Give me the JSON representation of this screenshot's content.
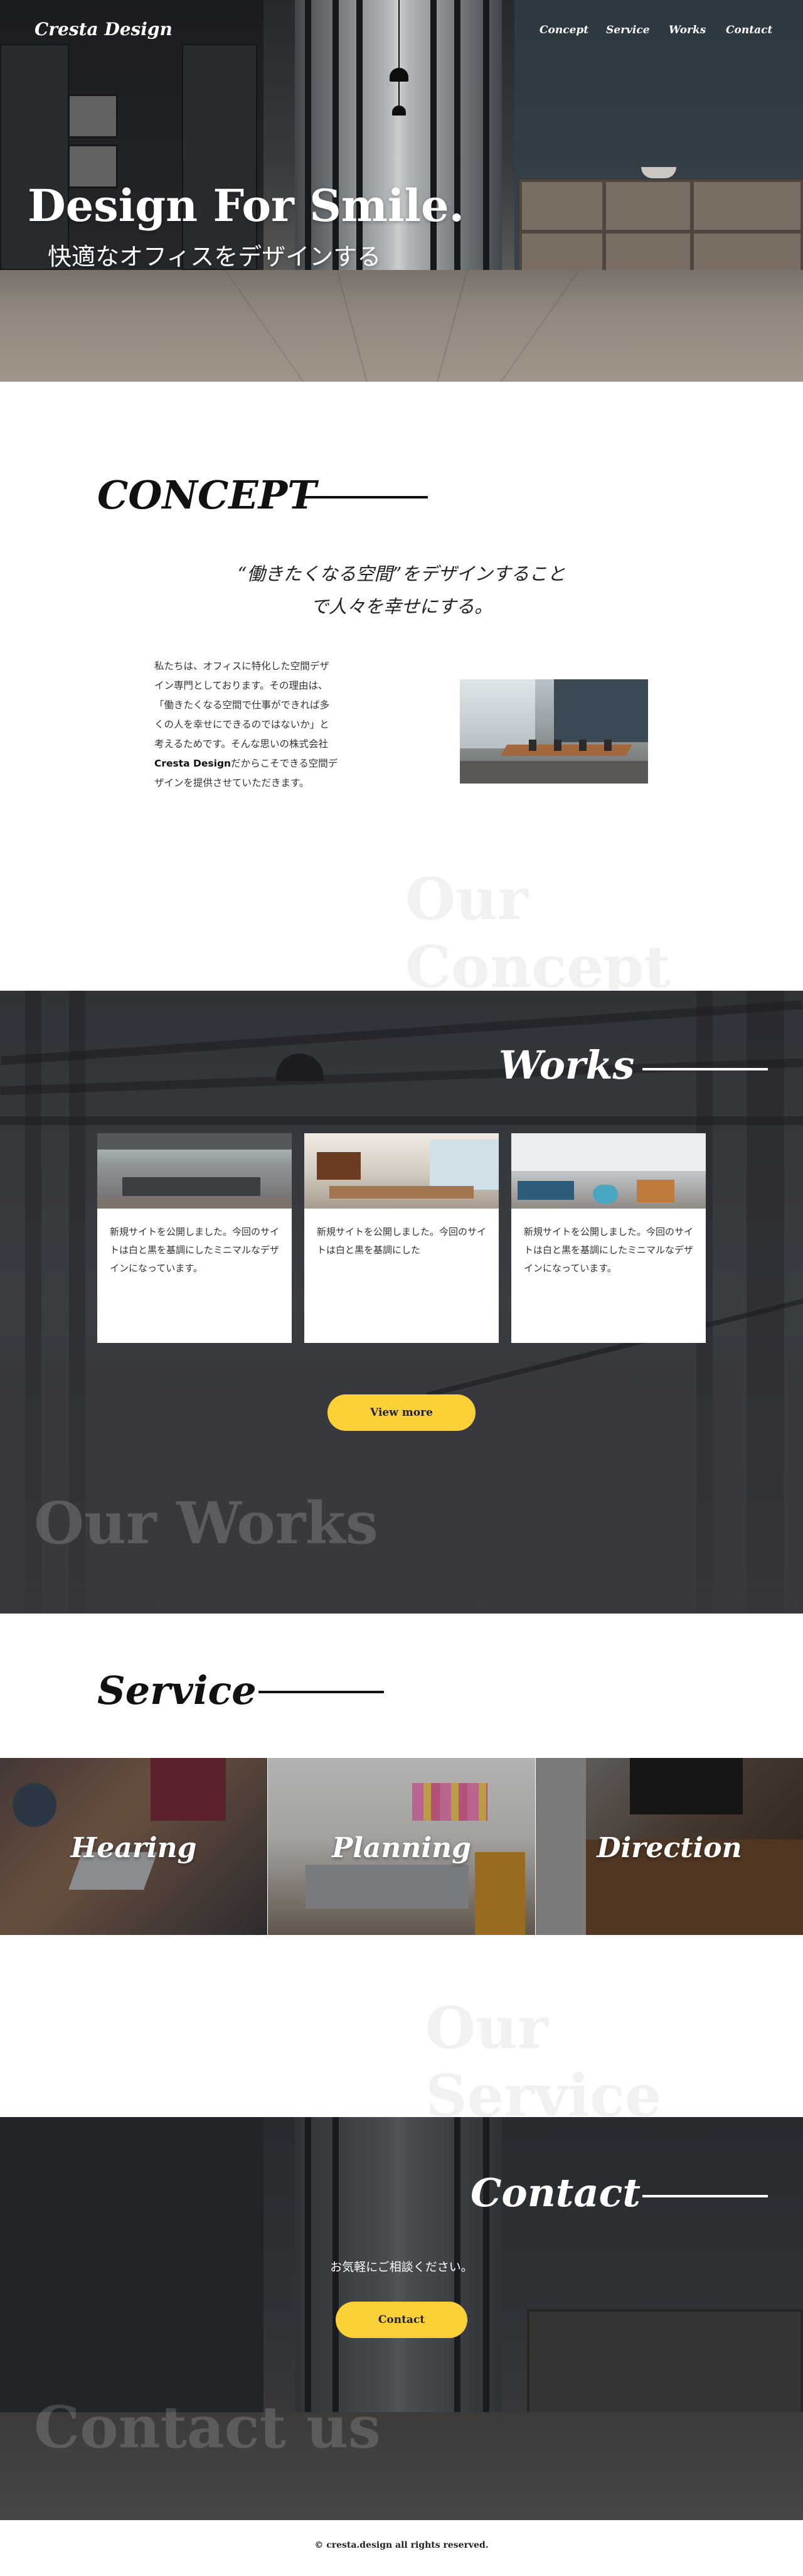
{
  "header": {
    "logo": "Cresta Design",
    "nav": [
      "Concept",
      "Service",
      "Works",
      "Contact"
    ]
  },
  "hero": {
    "title": "Design For Smile.",
    "subtitle": "快適なオフィスをデザインする"
  },
  "concept": {
    "title": "CONCEPT",
    "catch_line1": "“働きたくなる空間”をデザインすること",
    "catch_line2": "で人々を幸せにする。",
    "body_before": "私たちは、オフィスに特化した空間デザイン専門としております。その理由は、「働きたくなる空間で仕事ができれば多くの人を幸せにできるのではないか」と考えるためです。そんな思いの株式会社",
    "body_brand": "Cresta Design",
    "body_after": "だからこそできる空間デザインを提供させていただきます。",
    "watermark": "Our Concept"
  },
  "works": {
    "title": "Works",
    "cards": [
      {
        "text": "新規サイトを公開しました。今回のサイトは白と黒を基調にしたミニマルなデザインになっています。"
      },
      {
        "text": "新規サイトを公開しました。今回のサイトは白と黒を基調にした"
      },
      {
        "text": "新規サイトを公開しました。今回のサイトは白と黒を基調にしたミニマルなデザインになっています。"
      }
    ],
    "button": "View more",
    "watermark": "Our Works"
  },
  "service": {
    "title": "Service",
    "items": [
      "Hearing",
      "Planning",
      "Direction"
    ],
    "watermark": "Our Service"
  },
  "contact": {
    "title": "Contact",
    "text": "お気軽にご相談ください。",
    "button": "Contact",
    "watermark": "Contact us"
  },
  "footer": {
    "copyright": "© cresta.design all rights reserved."
  },
  "colors": {
    "accent": "#fbd137",
    "text": "#222222",
    "watermark_light": "#f1f1f1"
  }
}
